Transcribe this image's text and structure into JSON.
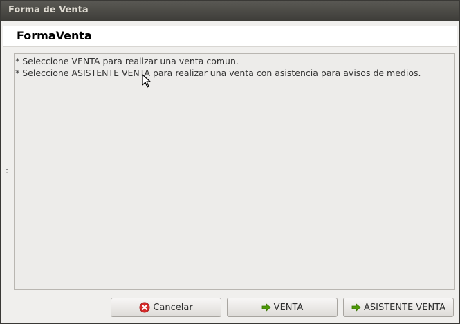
{
  "window": {
    "title": "Forma de Venta"
  },
  "header": {
    "title": "FormaVenta"
  },
  "side_handle": ":",
  "messages": [
    "* Seleccione VENTA para realizar una venta comun.",
    "* Seleccione ASISTENTE VENTA para realizar una venta con asistencia para avisos de medios."
  ],
  "buttons": {
    "cancel": {
      "label": "Cancelar",
      "icon": "cancel-icon",
      "color": "#d42a2a"
    },
    "venta": {
      "label": "VENTA",
      "icon": "arrow-right-icon",
      "color": "#4e9a06"
    },
    "asistente": {
      "label": "ASISTENTE VENTA",
      "icon": "arrow-right-icon",
      "color": "#4e9a06"
    }
  }
}
